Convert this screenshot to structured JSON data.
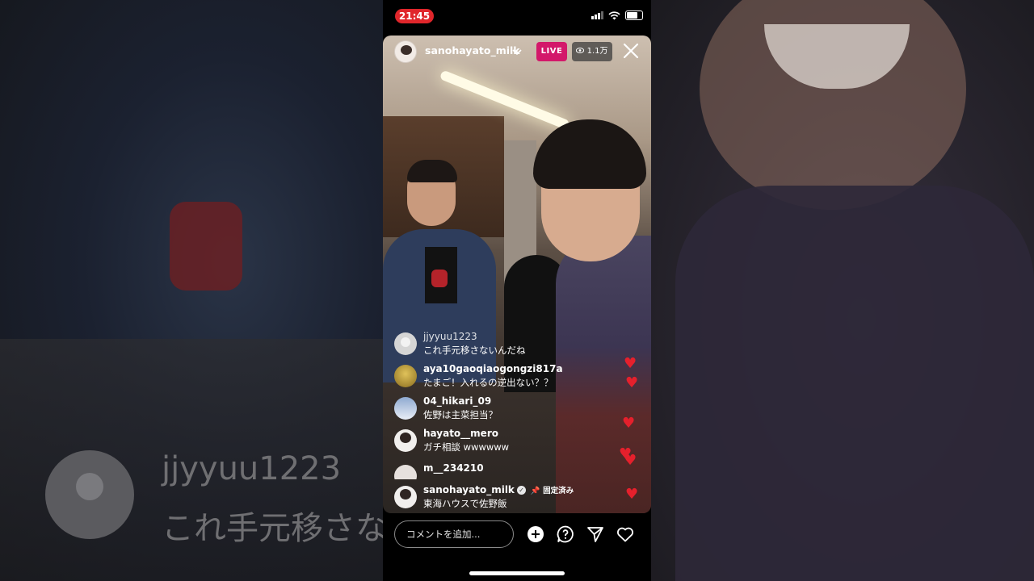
{
  "status_bar": {
    "time": "21:45"
  },
  "live": {
    "host": "sanohayato_milk",
    "live_label": "LIVE",
    "viewers": "1.1万"
  },
  "comments": [
    {
      "user": "jjyyuu1223",
      "text": "これ手元移さないんだね"
    },
    {
      "user": "aya10gaoqiaogongzi817a",
      "text": "たまご！入れるの逆出ない？？"
    },
    {
      "user": "04_hikari_09",
      "text": "佐野は主菜担当？"
    },
    {
      "user": "hayato__mero",
      "text": "ガチ相談 wwwwww"
    },
    {
      "user": "m__234210",
      "text": ""
    }
  ],
  "pinned_comment": {
    "user": "sanohayato_milk",
    "pinned_label": "固定済み",
    "text": "東海ハウスで佐野飯"
  },
  "background_ghost": {
    "user": "jjyyuu1223",
    "text": "これ手元移さな"
  },
  "comment_input": {
    "placeholder": "コメントを追加..."
  },
  "colors": {
    "live_badge": "#d3186a",
    "time_pill": "#e0262b",
    "heart": "#e5202c"
  },
  "icons": [
    "plus-icon",
    "question-icon",
    "send-icon",
    "heart-icon",
    "close-icon",
    "chevron-down-icon",
    "eye-icon",
    "verified-icon",
    "pin-icon"
  ]
}
